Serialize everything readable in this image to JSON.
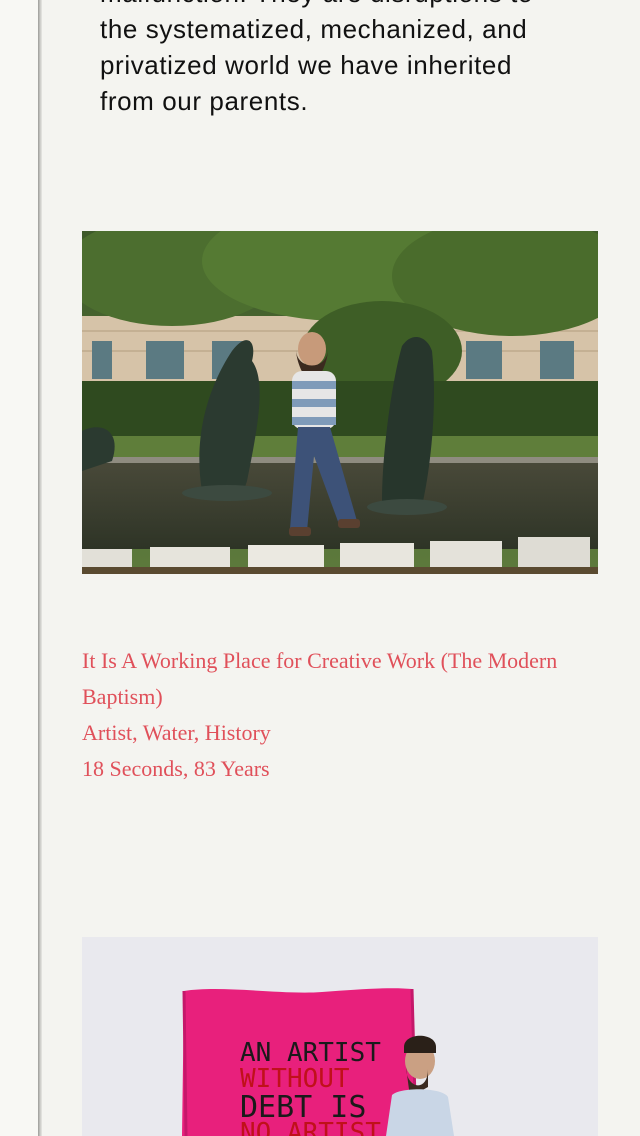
{
  "intro": {
    "lines": [
      "malfunction. They are disruptions to",
      "the systematized, mechanized, and",
      "privatized world we have inherited",
      "from our parents."
    ]
  },
  "project": {
    "title": "It Is A Working Place for Creative Work (The Modern Baptism)",
    "tags": "Artist, Water, History",
    "meta": "18 Seconds, 83 Years"
  },
  "banner": {
    "lines": [
      "AN ARTIST",
      "WITHOUT",
      "DEBT IS",
      "NO ARTIST"
    ]
  },
  "colors": {
    "background": "#f4f4f0",
    "accent": "#e0505a",
    "banner_pink": "#e8207c",
    "text": "#111111"
  }
}
